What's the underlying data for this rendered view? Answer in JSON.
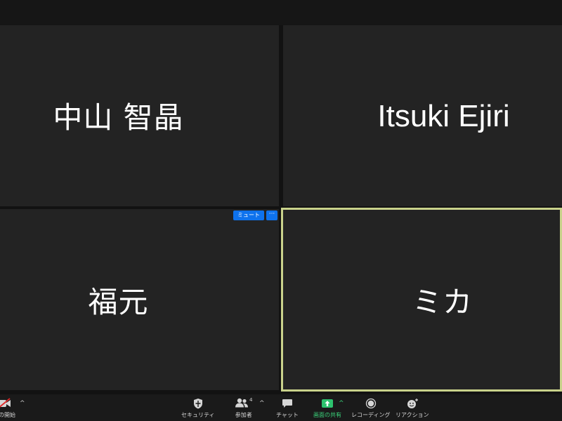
{
  "participants": [
    {
      "name": "中山 智晶"
    },
    {
      "name": "Itsuki Ejiri"
    },
    {
      "name": "福元",
      "actions": {
        "mute_label": "ミュート",
        "more_label": "···"
      }
    },
    {
      "name": "ミカ",
      "active_speaker": true
    }
  ],
  "toolbar": {
    "video_label": "オの開始",
    "security_label": "セキュリティ",
    "participants_label": "参加者",
    "participants_count": "4",
    "chat_label": "チャット",
    "share_label": "画面の共有",
    "record_label": "レコーディング",
    "reactions_label": "リアクション",
    "caret": "^"
  },
  "colors": {
    "tile_bg": "#232323",
    "active_border": "#c9d28b",
    "accent_blue": "#0e72ed",
    "share_green": "#3ad37a"
  }
}
